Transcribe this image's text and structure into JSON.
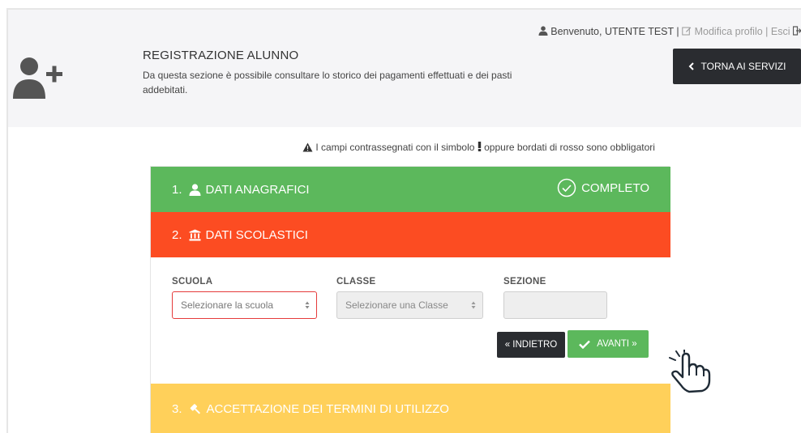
{
  "header": {
    "welcome": "Benvenuto, UTENTE TEST",
    "separator_1": " | ",
    "edit_profile": "Modifica profilo",
    "separator_2": " | ",
    "logout": "Esci",
    "title": "REGISTRAZIONE ALUNNO",
    "description": "Da questa sezione è possibile consultare lo storico dei pagamenti effettuati e dei pasti addebitati.",
    "back_button": "TORNA AI SERVIZI"
  },
  "notice": {
    "text_before": "I campi contrassegnati con il simbolo",
    "text_after": "oppure bordati di rosso sono obbligatori"
  },
  "steps": [
    {
      "number": "1.",
      "label": "DATI ANAGRAFICI",
      "status": "COMPLETO",
      "color": "#5cb85c",
      "icon": "user-icon"
    },
    {
      "number": "2.",
      "label": "DATI SCOLASTICI",
      "color": "#fc4c22",
      "icon": "bank-icon"
    },
    {
      "number": "3.",
      "label": "ACCETTAZIONE DEI TERMINI DI UTILIZZO",
      "color": "#ffd05a",
      "icon": "gavel-icon"
    }
  ],
  "form": {
    "scuola_label": "SCUOLA",
    "scuola_placeholder": "Selezionare la scuola",
    "classe_label": "CLASSE",
    "classe_placeholder": "Selezionare una Classe",
    "sezione_label": "SEZIONE",
    "sezione_value": "",
    "back_label": "« INDIETRO",
    "next_label": "AVANTI »"
  }
}
